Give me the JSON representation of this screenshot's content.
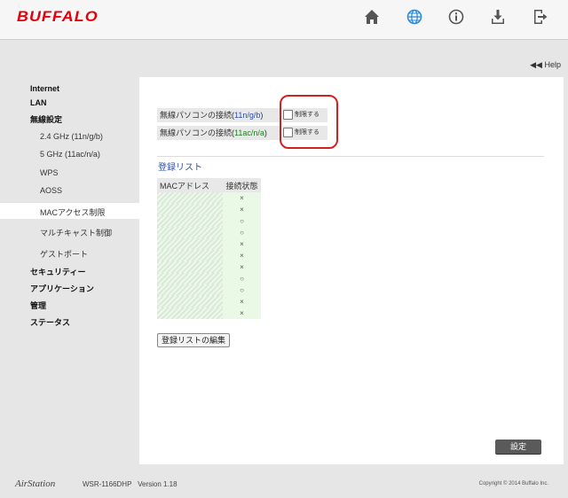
{
  "header": {
    "logo": "BUFFALO",
    "icons": [
      "home-icon",
      "globe-icon",
      "info-icon",
      "download-icon",
      "logout-icon"
    ],
    "help_label": "Help",
    "accent_color": "#e3000b",
    "active_icon_color": "#2a8ce0"
  },
  "sidebar": {
    "items": [
      {
        "label": "Internet"
      },
      {
        "label": "LAN"
      },
      {
        "label": "無線設定"
      },
      {
        "label": "2.4 GHz (11n/g/b)"
      },
      {
        "label": "5 GHz (11ac/n/a)"
      },
      {
        "label": "WPS"
      },
      {
        "label": "AOSS"
      },
      {
        "label": "MACアクセス制限",
        "active": true
      },
      {
        "label": "マルチキャスト制御"
      },
      {
        "label": "ゲストポート"
      },
      {
        "label": "セキュリティー"
      },
      {
        "label": "アプリケーション"
      },
      {
        "label": "管理"
      },
      {
        "label": "ステータス"
      }
    ]
  },
  "main": {
    "restrict_rows": [
      {
        "prefix": "無線パソコンの接続(",
        "band": "11n/g/b",
        "suffix": ")",
        "checkbox_label": "制限する",
        "checked": false
      },
      {
        "prefix": "無線パソコンの接続(",
        "band": "11ac/n/a",
        "suffix": ")",
        "checkbox_label": "制限する",
        "checked": false
      }
    ],
    "registration_title": "登録リスト",
    "table": {
      "headers": [
        "MACアドレス",
        "接続状態"
      ],
      "statuses": [
        "×",
        "×",
        "○",
        "○",
        "×",
        "×",
        "×",
        "○",
        "○",
        "×",
        "×"
      ]
    },
    "edit_button": "登録リストの編集",
    "save_button": "設定"
  },
  "footer": {
    "brand": "AirStation",
    "model": "WSR-1166DHP",
    "version": "Version 1.18",
    "copyright": "Copyright © 2014 Buffalo Inc."
  }
}
